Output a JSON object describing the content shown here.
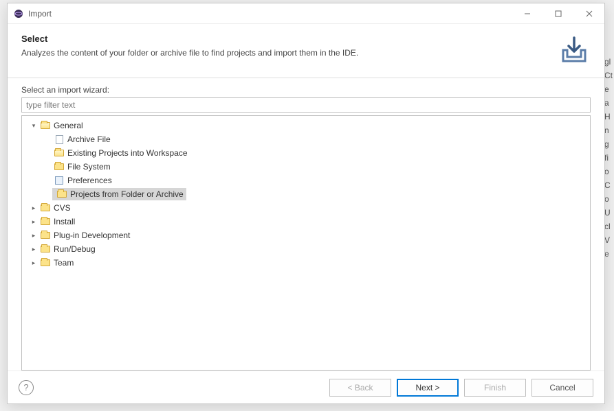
{
  "window": {
    "title": "Import"
  },
  "header": {
    "title": "Select",
    "description": "Analyzes the content of your folder or archive file to find projects and import them in the IDE."
  },
  "wizard": {
    "label": "Select an import wizard:",
    "filter_placeholder": "type filter text"
  },
  "tree": {
    "nodes": [
      {
        "label": "General",
        "expanded": true,
        "depth": 0,
        "icon": "folder-open",
        "selected": false,
        "children": true
      },
      {
        "label": "Archive File",
        "expanded": false,
        "depth": 1,
        "icon": "file",
        "selected": false,
        "children": false
      },
      {
        "label": "Existing Projects into Workspace",
        "expanded": false,
        "depth": 1,
        "icon": "folder-open",
        "selected": false,
        "children": false
      },
      {
        "label": "File System",
        "expanded": false,
        "depth": 1,
        "icon": "folder",
        "selected": false,
        "children": false
      },
      {
        "label": "Preferences",
        "expanded": false,
        "depth": 1,
        "icon": "pref",
        "selected": false,
        "children": false
      },
      {
        "label": "Projects from Folder or Archive",
        "expanded": false,
        "depth": 1,
        "icon": "folder",
        "selected": true,
        "children": false
      },
      {
        "label": "CVS",
        "expanded": false,
        "depth": 0,
        "icon": "folder",
        "selected": false,
        "children": true
      },
      {
        "label": "Install",
        "expanded": false,
        "depth": 0,
        "icon": "folder",
        "selected": false,
        "children": true
      },
      {
        "label": "Plug-in Development",
        "expanded": false,
        "depth": 0,
        "icon": "folder",
        "selected": false,
        "children": true
      },
      {
        "label": "Run/Debug",
        "expanded": false,
        "depth": 0,
        "icon": "folder",
        "selected": false,
        "children": true
      },
      {
        "label": "Team",
        "expanded": false,
        "depth": 0,
        "icon": "folder",
        "selected": false,
        "children": true
      }
    ]
  },
  "buttons": {
    "back": "< Back",
    "next": "Next >",
    "finish": "Finish",
    "cancel": "Cancel"
  },
  "bg_letters": [
    "gl",
    "Ct",
    "",
    "e",
    "a",
    "H",
    "",
    "n",
    "g",
    "fi",
    "o",
    "C",
    "o",
    "U",
    "cl",
    "V",
    "e"
  ]
}
